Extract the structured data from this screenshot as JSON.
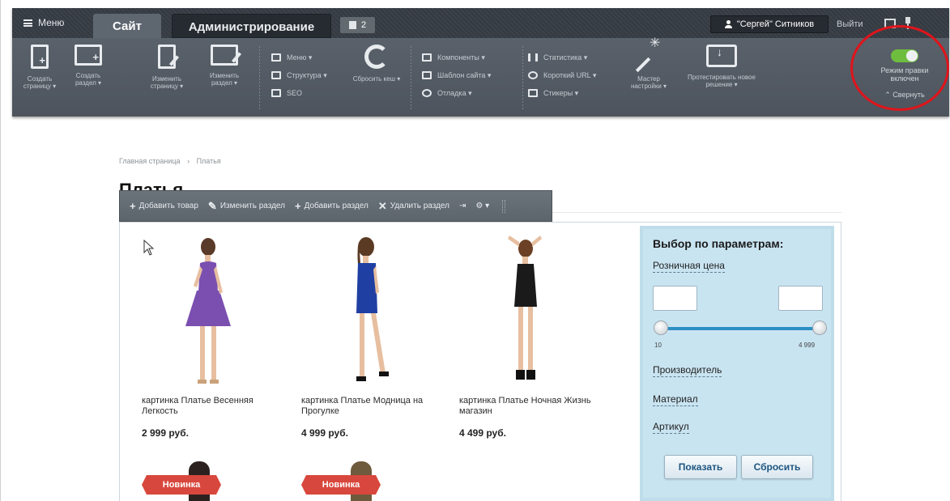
{
  "admin": {
    "menu_label": "Меню",
    "tab_site": "Сайт",
    "tab_admin": "Администрирование",
    "notifications_count": "2",
    "user_name": "\"Сергей\" Ситников",
    "logout": "Выйти",
    "tools": {
      "create_page": "Создать страницу ▾",
      "create_section": "Создать раздел ▾",
      "edit_page": "Изменить страницу ▾",
      "edit_section": "Изменить раздел ▾",
      "menu": "Меню ▾",
      "structure": "Структура ▾",
      "seo": "SEO",
      "clear_cache": "Сбросить кеш ▾",
      "components": "Компоненты ▾",
      "site_template": "Шаблон сайта ▾",
      "debug": "Отладка ▾",
      "statistics": "Статистика ▾",
      "short_url": "Короткий URL ▾",
      "stickers": "Стикеры ▾",
      "wizard": "Мастер настройки ▾",
      "test_solution": "Протестировать новое решение ▾"
    },
    "edit_mode_label": "Режим правки включен",
    "collapse": "⌃ Свернуть"
  },
  "page": {
    "breadcrumb": [
      "Главная страница",
      "›",
      "Платья"
    ],
    "title": "Платья"
  },
  "edit_bar": {
    "add_item": "Добавить товар",
    "edit_section": "Изменить раздел",
    "add_section": "Добавить раздел",
    "delete_section": "Удалить раздел",
    "more": "⇥",
    "gear": "⚙ ▾"
  },
  "products": [
    {
      "name": "картинка Платье Весенняя Легкость",
      "price": "2 999 руб.",
      "dress_color": "#7a4fb0"
    },
    {
      "name": "картинка Платье Модница на Прогулке",
      "price": "4 999 руб.",
      "dress_color": "#1f3fa3"
    },
    {
      "name": "картинка Платье Ночная Жизнь магазин",
      "price": "4 499 руб.",
      "dress_color": "#1a1a1a"
    }
  ],
  "ribbons": [
    "Новинка",
    "Новинка"
  ],
  "filter": {
    "title": "Выбор по параметрам:",
    "retail_price": "Розничная цена",
    "min": "10",
    "max": "4 999",
    "manufacturer": "Производитель",
    "material": "Материал",
    "article": "Артикул",
    "show_button": "Показать",
    "reset_button": "Сбросить"
  }
}
